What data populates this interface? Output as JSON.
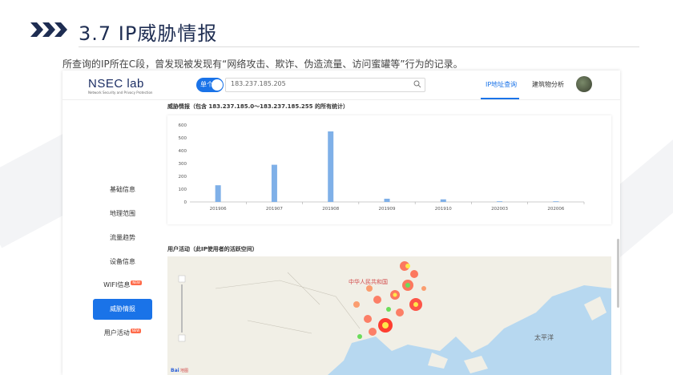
{
  "slide": {
    "title": "3.7 IP威胁情报",
    "description": "所查询的IP所在C段，曾发现被发现有“网络攻击、欺诈、伪造流量、访问蜜罐等”行为的记录。"
  },
  "app": {
    "logo": "NSEC lab",
    "logo_sub": "Network Security and Privacy Protection",
    "mode_label": "单个",
    "ip_value": "183.237.185.205",
    "tabs": [
      {
        "label": "IP地址查询",
        "active": true
      },
      {
        "label": "建筑物分析",
        "active": false
      }
    ],
    "sidebar": [
      {
        "label": "基础信息",
        "badge": "",
        "active": false
      },
      {
        "label": "地理范围",
        "badge": "",
        "active": false
      },
      {
        "label": "流量趋势",
        "badge": "",
        "active": false
      },
      {
        "label": "设备信息",
        "badge": "",
        "active": false
      },
      {
        "label": "WIFI信息",
        "badge": "NEW",
        "active": false
      },
      {
        "label": "威胁情报",
        "badge": "",
        "active": true
      },
      {
        "label": "用户活动",
        "badge": "NEW",
        "active": false
      }
    ],
    "threat_section_title": "威胁情报（包含 183.237.185.0～183.237.185.255 的所有统计）",
    "activity_section_title": "用户活动（此IP使用者的活跃空间）",
    "map_labels": {
      "china": "中华人民共和国",
      "pacific": "太平洋",
      "baidu": "Bai",
      "baidu_du": "地图"
    },
    "colors": {
      "accent": "#1a73e8",
      "bar": "#7fb0e8",
      "title_navy": "#1e2d52"
    }
  },
  "chart_data": {
    "type": "bar",
    "categories": [
      "201906",
      "201907",
      "201908",
      "201909",
      "201910",
      "202003",
      "202006"
    ],
    "values": [
      130,
      290,
      550,
      25,
      20,
      5,
      5
    ],
    "ylim": [
      0,
      600
    ],
    "yticks": [
      0,
      100,
      200,
      300,
      400,
      500,
      600
    ],
    "grid": false,
    "title": "",
    "xlabel": "",
    "ylabel": ""
  }
}
